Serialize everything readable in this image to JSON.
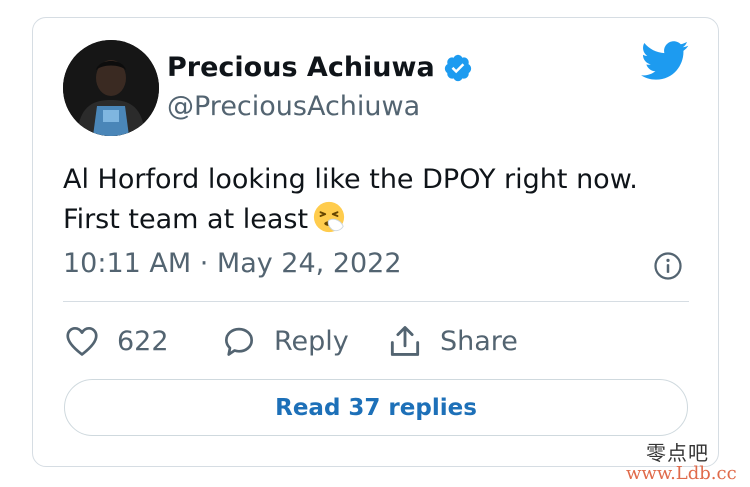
{
  "tweet": {
    "author_name": "Precious Achiuwa",
    "author_handle": "@PreciousAchiuwa",
    "text": "Al Horford looking like the DPOY right now. First team at least",
    "timestamp": "10:11 AM · May 24, 2022",
    "likes": "622",
    "reply_label": "Reply",
    "share_label": "Share",
    "read_replies_label": "Read 37 replies"
  },
  "icons": {
    "avatar": "avatar",
    "verified": "verified-badge-icon",
    "brand": "twitter-bird-icon",
    "emoji": "sneezing-face-emoji",
    "info": "info-icon",
    "like": "heart-icon",
    "reply": "speech-bubble-icon",
    "share": "share-icon"
  },
  "colors": {
    "brand_blue": "#1d9bf0",
    "button_text": "#1d70b8",
    "text": "#0f1419",
    "muted": "#536471",
    "border": "#d6dde3"
  },
  "watermark": {
    "cn": "零点吧",
    "url": "www.Ldb.cc"
  }
}
